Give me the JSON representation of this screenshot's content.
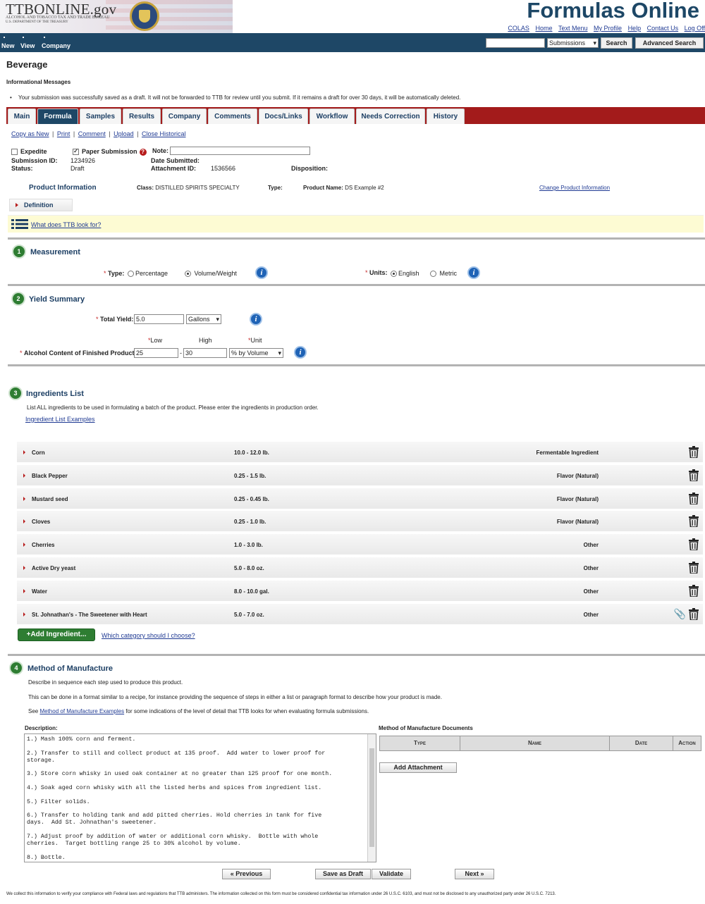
{
  "header": {
    "logo_title": "TTBONLINE.gov",
    "logo_sub1": "ALCOHOL AND TOBACCO TAX AND TRADE BUREAU",
    "logo_sub2": "U.S. DEPARTMENT OF THE TREASURY",
    "app_title": "Formulas Online",
    "links": [
      "COLAS",
      "Home",
      "Text Menu",
      "My Profile",
      "Help",
      "Contact Us",
      "Log Off"
    ]
  },
  "nav": {
    "items": [
      "New",
      "View",
      "Company"
    ],
    "search_value": "",
    "search_scope": "Submissions",
    "search_button": "Search",
    "advanced_search": "Advanced Search"
  },
  "page": {
    "heading": "Beverage",
    "info_title": "Informational Messages",
    "info_message": "Your submission was successfully saved as a draft. It will not be forwarded to TTB for review until you submit. If it remains a draft for over 30 days, it will be automatically deleted."
  },
  "tabs": [
    "Main",
    "Formula",
    "Samples",
    "Results",
    "Company",
    "Comments",
    "Docs/Links",
    "Workflow",
    "Needs Correction",
    "History"
  ],
  "active_tab": "Formula",
  "actions": [
    "Copy as New",
    "Print",
    "Comment",
    "Upload",
    "Close Historical"
  ],
  "submission": {
    "expedite_label": "Expedite",
    "expedite_checked": false,
    "paper_label": "Paper Submission",
    "paper_checked": true,
    "note_label": "Note:",
    "note_value": "",
    "submission_id_label": "Submission ID:",
    "submission_id": "1234926",
    "status_label": "Status:",
    "status": "Draft",
    "date_submitted_label": "Date Submitted:",
    "date_submitted": "",
    "attachment_id_label": "Attachment ID:",
    "attachment_id": "1536566",
    "disposition_label": "Disposition:",
    "disposition": ""
  },
  "product": {
    "title": "Product Information",
    "class_label": "Class:",
    "class_value": "DISTILLED SPIRITS SPECIALTY",
    "type_label": "Type:",
    "type_value": "",
    "name_label": "Product Name:",
    "name_value": "DS Example #2",
    "change_link": "Change Product Information"
  },
  "definition_label": "Definition",
  "what_look_link": "What does TTB look for?",
  "measurement": {
    "step": "1",
    "title": "Measurement",
    "type_label": "Type:",
    "type_options": [
      "Percentage",
      "Volume/Weight"
    ],
    "type_selected": "Volume/Weight",
    "units_label": "Units:",
    "units_options": [
      "English",
      "Metric"
    ],
    "units_selected": "English"
  },
  "yield": {
    "step": "2",
    "title": "Yield Summary",
    "total_label": "Total Yield:",
    "total_value": "5.0",
    "total_unit": "Gallons",
    "low_label": "Low",
    "high_label": "High",
    "unit_label": "Unit",
    "alcohol_label": "Alcohol Content of Finished Product:",
    "alcohol_low": "25",
    "alcohol_high": "30",
    "alcohol_unit": "% by Volume",
    "dash": "-"
  },
  "ingredients": {
    "step": "3",
    "title": "Ingredients List",
    "instructions": "List ALL ingredients to be used in formulating a batch of the product. Please enter the ingredients in production order.",
    "examples_link": "Ingredient List Examples",
    "rows": [
      {
        "name": "Corn",
        "qty": "10.0 - 12.0 lb.",
        "category": "Fermentable Ingredient",
        "attachment": false
      },
      {
        "name": "Black Pepper",
        "qty": "0.25 - 1.5 lb.",
        "category": "Flavor (Natural)",
        "attachment": false
      },
      {
        "name": "Mustard seed",
        "qty": "0.25 - 0.45 lb.",
        "category": "Flavor (Natural)",
        "attachment": false
      },
      {
        "name": "Cloves",
        "qty": "0.25 - 1.0 lb.",
        "category": "Flavor (Natural)",
        "attachment": false
      },
      {
        "name": "Cherries",
        "qty": "1.0 - 3.0 lb.",
        "category": "Other",
        "attachment": false
      },
      {
        "name": "Active Dry yeast",
        "qty": "5.0 - 8.0 oz.",
        "category": "Other",
        "attachment": false
      },
      {
        "name": "Water",
        "qty": "8.0 - 10.0 gal.",
        "category": "Other",
        "attachment": false
      },
      {
        "name": "St. Johnathan's - The Sweetener with Heart",
        "qty": "5.0 - 7.0 oz.",
        "category": "Other",
        "attachment": true
      }
    ],
    "add_button": "+Add Ingredient...",
    "category_link": "Which category should I choose?"
  },
  "manufacture": {
    "step": "4",
    "title": "Method of Manufacture",
    "line1": "Describe in sequence each step used to produce this product.",
    "line2": "This can be done in a format similar to a recipe, for instance providing the sequence of steps in either a list or paragraph format to describe how your product is made.",
    "line3_pre": "See ",
    "line3_link": "Method of Manufacture Examples",
    "line3_post": " for some indications of the level of detail that TTB looks for when evaluating formula submissions.",
    "description_label": "Description:",
    "steps": [
      "1.) Mash 100% corn and ferment.",
      "2.) Transfer to still and collect product at 135 proof.  Add water to lower proof for\nstorage.",
      "3.) Store corn whisky in used oak container at no greater than 125 proof for one month.",
      "4.) Soak aged corn whisky with all the listed herbs and spices from ingredient list.",
      "5.) Filter solids.",
      "6.) Transfer to holding tank and add pitted cherries. Hold cherries in tank for five\ndays.  Add St. Johnathan's sweetener.",
      "7.) Adjust proof by addition of water or additional corn whisky.  Bottle with whole\ncherries.  Target bottling range 25 to 30% alcohol by volume.",
      "8.) Bottle."
    ],
    "documents_label": "Method of Manufacture Documents",
    "doc_columns": [
      "Type",
      "Name",
      "Date",
      "Action"
    ],
    "add_attachment": "Add Attachment"
  },
  "bottom_buttons": {
    "previous": "« Previous",
    "save_draft": "Save as Draft",
    "validate": "Validate",
    "next": "Next »"
  },
  "footer_note": "We collect this information to verify your compliance with Federal laws and regulations that TTB administers. The information collected on this form must be considered confidential tax information under 26 U.S.C. 6103, and must not be disclosed to any unauthorized party under 26 U.S.C. 7213."
}
